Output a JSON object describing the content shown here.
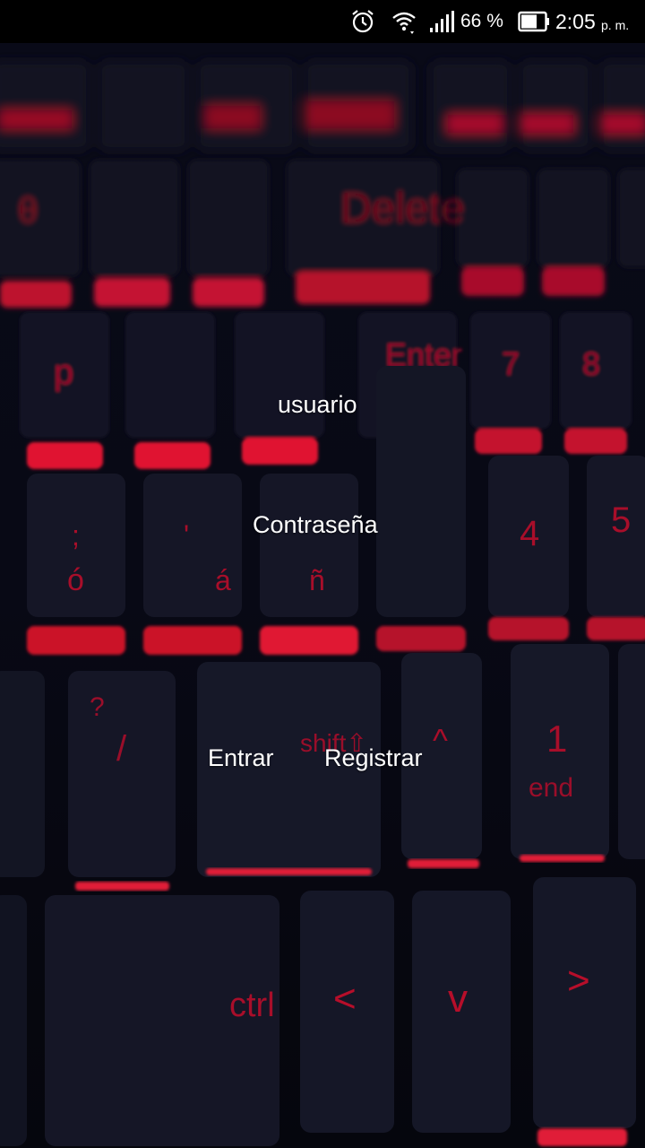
{
  "status_bar": {
    "battery_percent": "66 %",
    "time": "2:05",
    "ampm": "p. m.",
    "icons": [
      "alarm-icon",
      "wifi-icon",
      "signal-icon",
      "battery-icon"
    ]
  },
  "login": {
    "username_label": "usuario",
    "password_label": "Contraseña",
    "enter_button": "Entrar",
    "register_button": "Registrar"
  },
  "background": {
    "description_color_accent": "#ff1430",
    "base_color": "#0a0b18"
  }
}
